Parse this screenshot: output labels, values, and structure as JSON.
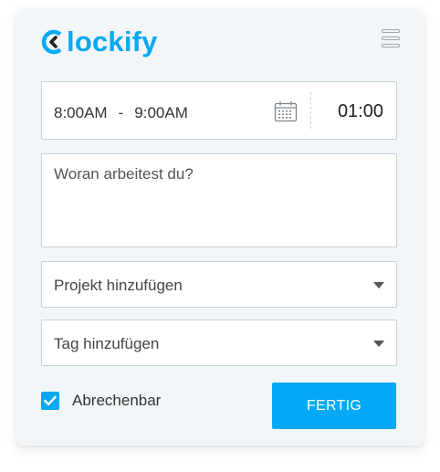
{
  "brand": {
    "name": "lockify",
    "color": "#03a9f4"
  },
  "header": {
    "menu_icon": "hamburger-menu-icon"
  },
  "time_entry": {
    "start_time": "8:00AM",
    "separator": "-",
    "end_time": "9:00AM",
    "calendar_icon": "calendar-icon",
    "duration": "01:00"
  },
  "description": {
    "placeholder": "Woran arbeitest du?"
  },
  "project": {
    "label": "Projekt hinzufügen"
  },
  "tag": {
    "label": "Tag hinzufügen"
  },
  "billable": {
    "label": "Abrechenbar",
    "checked": true
  },
  "submit": {
    "label": "FERTIG"
  }
}
